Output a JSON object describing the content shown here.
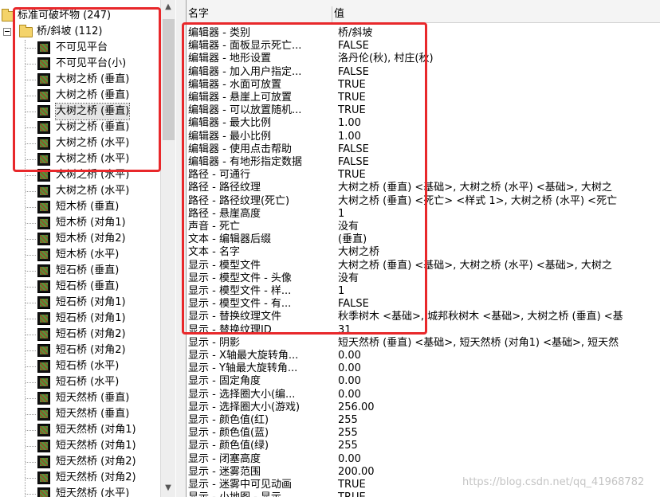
{
  "tree": {
    "root": "标准可破坏物 (247)",
    "folder": "桥/斜坡 (112)",
    "items": [
      "不可见平台",
      "不可见平台(小)",
      "大树之桥 (垂直)",
      "大树之桥 (垂直)",
      "大树之桥 (垂直)",
      "大树之桥 (垂直)",
      "大树之桥 (水平)",
      "大树之桥 (水平)",
      "大树之桥 (水平)",
      "大树之桥 (水平)",
      "短木桥 (垂直)",
      "短木桥 (对角1)",
      "短木桥 (对角2)",
      "短木桥 (水平)",
      "短石桥 (垂直)",
      "短石桥 (垂直)",
      "短石桥 (对角1)",
      "短石桥 (对角1)",
      "短石桥 (对角2)",
      "短石桥 (对角2)",
      "短石桥 (水平)",
      "短石桥 (水平)",
      "短天然桥 (垂直)",
      "短天然桥 (垂直)",
      "短天然桥 (对角1)",
      "短天然桥 (对角1)",
      "短天然桥 (对角2)",
      "短天然桥 (对角2)",
      "短天然桥 (水平)"
    ]
  },
  "grid": {
    "header_name": "名字",
    "header_value": "值",
    "rows": [
      [
        "编辑器 - 类别",
        "桥/斜坡"
      ],
      [
        "编辑器 - 面板显示死亡...",
        "FALSE"
      ],
      [
        "编辑器 - 地形设置",
        "洛丹伦(秋), 村庄(秋)"
      ],
      [
        "编辑器 - 加入用户指定...",
        "FALSE"
      ],
      [
        "编辑器 - 水面可放置",
        "TRUE"
      ],
      [
        "编辑器 - 悬崖上可放置",
        "TRUE"
      ],
      [
        "编辑器 - 可以放置随机...",
        "TRUE"
      ],
      [
        "编辑器 - 最大比例",
        "1.00"
      ],
      [
        "编辑器 - 最小比例",
        "1.00"
      ],
      [
        "编辑器 - 使用点击帮助",
        "FALSE"
      ],
      [
        "编辑器 - 有地形指定数据",
        "FALSE"
      ],
      [
        "路径 - 可通行",
        "TRUE"
      ],
      [
        "路径 - 路径纹理",
        "大树之桥 (垂直) <基础>, 大树之桥 (水平) <基础>, 大树之"
      ],
      [
        "路径 - 路径纹理(死亡)",
        "大树之桥 (垂直) <死亡> <样式 1>, 大树之桥 (水平) <死亡"
      ],
      [
        "路径 - 悬崖高度",
        "1"
      ],
      [
        "声音 - 死亡",
        "没有"
      ],
      [
        "文本 - 编辑器后缀",
        "(垂直)"
      ],
      [
        "文本 - 名字",
        "大树之桥"
      ],
      [
        "显示 - 模型文件",
        "大树之桥 (垂直) <基础>, 大树之桥 (水平) <基础>, 大树之"
      ],
      [
        "显示 - 模型文件 - 头像",
        "没有"
      ],
      [
        "显示 - 模型文件 - 样...",
        "1"
      ],
      [
        "显示 - 模型文件 - 有...",
        "FALSE"
      ],
      [
        "显示 - 替换纹理文件",
        "秋季树木 <基础>, 城邦秋树木 <基础>, 大树之桥 (垂直) <基"
      ],
      [
        "显示 - 替换纹理ID",
        "31"
      ],
      [
        "显示 - 阴影",
        "短天然桥 (垂直) <基础>, 短天然桥 (对角1) <基础>, 短天然"
      ],
      [
        "显示 - X轴最大旋转角...",
        "0.00"
      ],
      [
        "显示 - Y轴最大旋转角...",
        "0.00"
      ],
      [
        "显示 - 固定角度",
        "0.00"
      ],
      [
        "显示 - 选择圈大小(编...",
        "0.00"
      ],
      [
        "显示 - 选择圈大小(游戏)",
        "256.00"
      ],
      [
        "显示 - 颜色值(红)",
        "255"
      ],
      [
        "显示 - 颜色值(蓝)",
        "255"
      ],
      [
        "显示 - 颜色值(绿)",
        "255"
      ],
      [
        "显示 - 闭塞高度",
        "0.00"
      ],
      [
        "显示 - 迷雾范围",
        "200.00"
      ],
      [
        "显示 - 迷雾中可见动画",
        "TRUE"
      ],
      [
        "显示 - 小地图 - 显示",
        "TRUE"
      ]
    ]
  },
  "watermark": "https://blog.csdn.net/qq_41968782"
}
